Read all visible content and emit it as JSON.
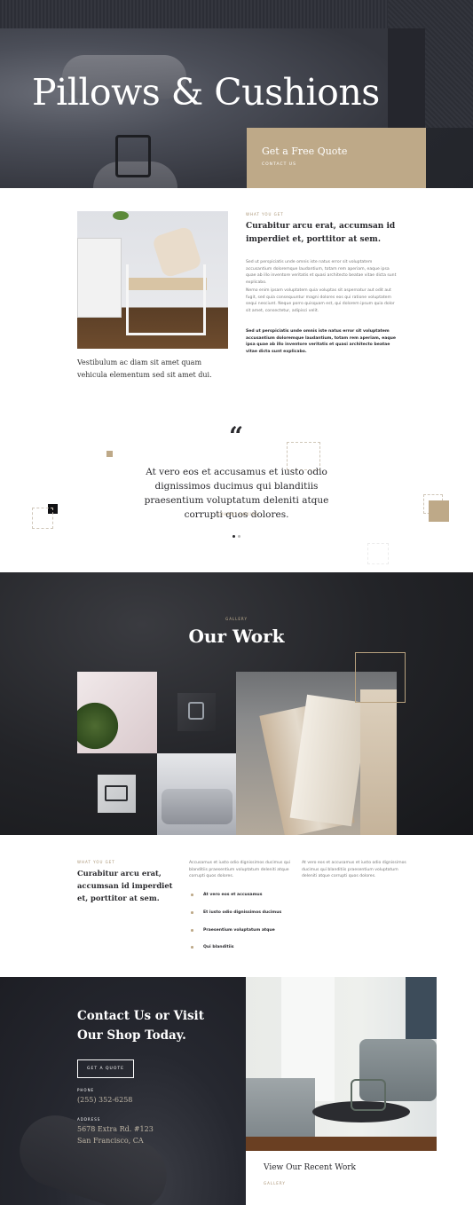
{
  "colors": {
    "accent": "#bea988",
    "dark": "#23252b",
    "text": "#2a2a2e"
  },
  "hero": {
    "title": "Pillows & Cushions",
    "cta_title": "Get a Free Quote",
    "cta_link": "CONTACT US"
  },
  "about": {
    "caption": "Vestibulum ac diam sit amet quam vehicula elementum sed sit amet dui.",
    "eyebrow": "WHAT YOU GET",
    "heading": "Curabitur arcu erat, accumsan id imperdiet et, porttitor at sem.",
    "p1": "Sed ut perspiciatis unde omnis iste natus error sit voluptatem accusantium doloremque laudantium, totam rem aperiam, eaque ipsa quae ab illo inventore veritatis et quasi architecto beatae vitae dicta sunt explicabo.",
    "p2": "Nemo enim ipsam voluptatem quia voluptas sit aspernatur aut odit aut fugit, sed quia consequuntur magni dolores eos qui ratione voluptatem sequi nesciunt. Neque porro quisquam est, qui dolorem ipsum quia dolor sit amet, consectetur, adipisci velit.",
    "p3": "Sed ut perspiciatis unde omnis iste natus error sit voluptatem accusantium doloremque laudantium, totam rem aperiam, eaque ipsa quae ab illo inventore veritatis et quasi architecto beatae vitae dicta sunt explicabo."
  },
  "testimonial": {
    "quote_mark": "“",
    "text": "At vero eos et accusamus et iusto odio dignissimos ducimus qui blanditiis praesentium voluptatum deleniti atque corrupti quos dolores.",
    "author": "– JOHNNY ADKINS",
    "slide_index": 1,
    "slide_count": 2
  },
  "gallery": {
    "eyebrow": "GALLERY",
    "title": "Our Work"
  },
  "features": {
    "eyebrow": "WHAT YOU GET",
    "heading": "Curabitur arcu erat, accumsan id imperdiet et, porttitor at sem.",
    "p1": "Accusamus et iusto odio dignissimos ducimus qui blanditiis praesentium voluptatum deleniti atque corrupti quos dolores.",
    "p2": "At vero eos et accusamus et iusto odio dignissimos ducimus qui blanditiis praesentium voluptatum deleniti atque corrupti quos dolores.",
    "items": [
      "At vero eos et accusamus",
      "Et iusto odio dignissimos ducimus",
      "Praesentium voluptatum atque",
      "Qui blanditiis"
    ]
  },
  "contact": {
    "title": "Contact Us or Visit Our Shop Today.",
    "button": "GET A QUOTE",
    "phone_label": "PHONE",
    "phone": "(255) 352-6258",
    "address_label": "ADDRESS",
    "address_line1": "5678 Extra Rd. #123",
    "address_line2": "San Francisco, CA",
    "work_title": "View Our Recent Work",
    "work_link": "GALLERY"
  }
}
